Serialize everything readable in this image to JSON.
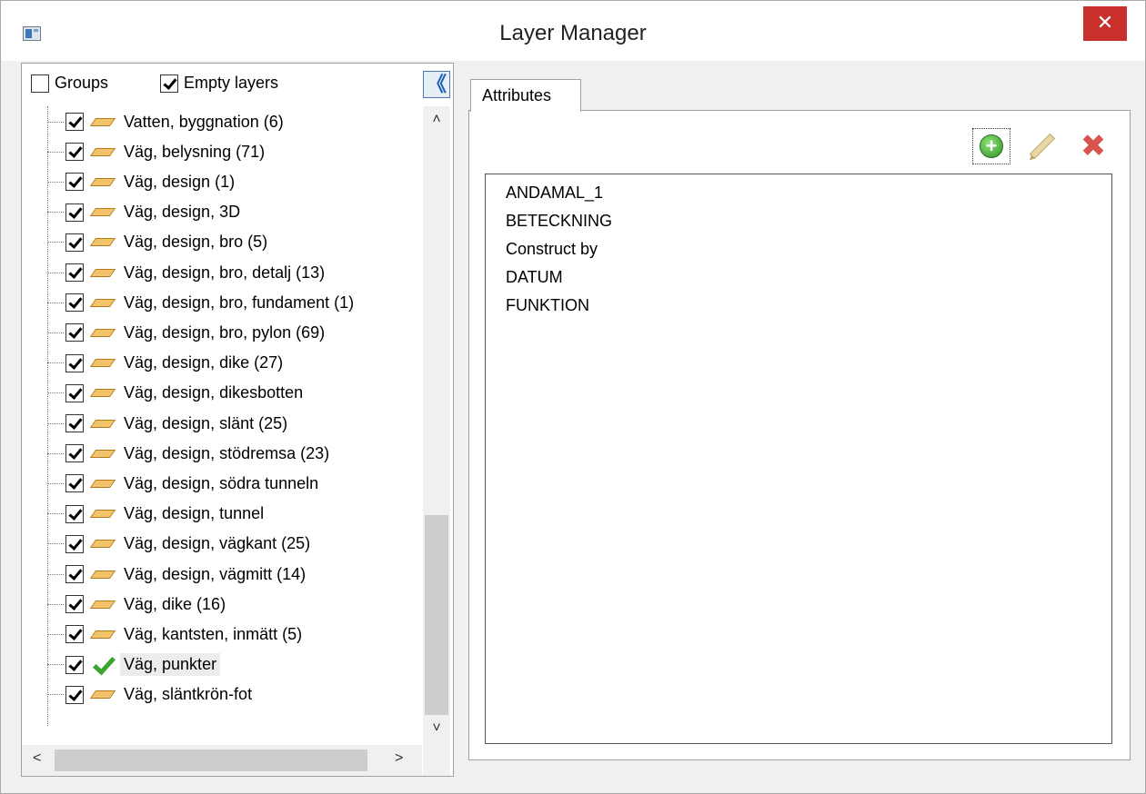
{
  "window": {
    "title": "Layer Manager",
    "close_glyph": "✕",
    "app_icon": "layer-manager-icon"
  },
  "options": {
    "groups": {
      "label": "Groups",
      "checked": false
    },
    "empty_layers": {
      "label": "Empty layers",
      "checked": true
    },
    "collapse_glyph": "《"
  },
  "layers": [
    {
      "label": "Vatten, byggnation (6)",
      "checked": true,
      "icon": "layer-icon"
    },
    {
      "label": "Väg, belysning (71)",
      "checked": true,
      "icon": "layer-icon"
    },
    {
      "label": "Väg, design (1)",
      "checked": true,
      "icon": "layer-icon"
    },
    {
      "label": "Väg, design, 3D",
      "checked": true,
      "icon": "layer-icon"
    },
    {
      "label": "Väg, design, bro (5)",
      "checked": true,
      "icon": "layer-icon"
    },
    {
      "label": "Väg, design, bro, detalj (13)",
      "checked": true,
      "icon": "layer-icon"
    },
    {
      "label": "Väg, design, bro, fundament (1)",
      "checked": true,
      "icon": "layer-icon"
    },
    {
      "label": "Väg, design, bro, pylon (69)",
      "checked": true,
      "icon": "layer-icon"
    },
    {
      "label": "Väg, design, dike (27)",
      "checked": true,
      "icon": "layer-icon"
    },
    {
      "label": "Väg, design, dikesbotten",
      "checked": true,
      "icon": "layer-icon"
    },
    {
      "label": "Väg, design, slänt (25)",
      "checked": true,
      "icon": "layer-icon"
    },
    {
      "label": "Väg, design, stödremsa (23)",
      "checked": true,
      "icon": "layer-icon"
    },
    {
      "label": "Väg, design, södra tunneln",
      "checked": true,
      "icon": "layer-icon"
    },
    {
      "label": "Väg, design, tunnel",
      "checked": true,
      "icon": "layer-icon"
    },
    {
      "label": "Väg, design, vägkant (25)",
      "checked": true,
      "icon": "layer-icon"
    },
    {
      "label": "Väg, design, vägmitt (14)",
      "checked": true,
      "icon": "layer-icon"
    },
    {
      "label": "Väg, dike (16)",
      "checked": true,
      "icon": "layer-icon"
    },
    {
      "label": "Väg, kantsten, inmätt (5)",
      "checked": true,
      "icon": "layer-icon"
    },
    {
      "label": "Väg, punkter",
      "checked": true,
      "icon": "active-check-icon",
      "selected": true
    },
    {
      "label": "Väg, släntkrön-fot",
      "checked": true,
      "icon": "layer-icon"
    }
  ],
  "scroll": {
    "up": "˄",
    "down": "˅",
    "left": "<",
    "right": ">"
  },
  "tabs": [
    {
      "label": "Attributes"
    }
  ],
  "toolbar": {
    "add": {
      "icon": "add-icon",
      "glyph": "+"
    },
    "edit": {
      "icon": "edit-icon"
    },
    "delete": {
      "icon": "delete-icon",
      "glyph": "✖"
    }
  },
  "attributes": [
    "ANDAMAL_1",
    "BETECKNING",
    "Construct by",
    "DATUM",
    "FUNKTION"
  ],
  "colors": {
    "close": "#c9302c",
    "add": "#2e8f22",
    "delete": "#d9534f",
    "layer": "#f3c36b"
  }
}
